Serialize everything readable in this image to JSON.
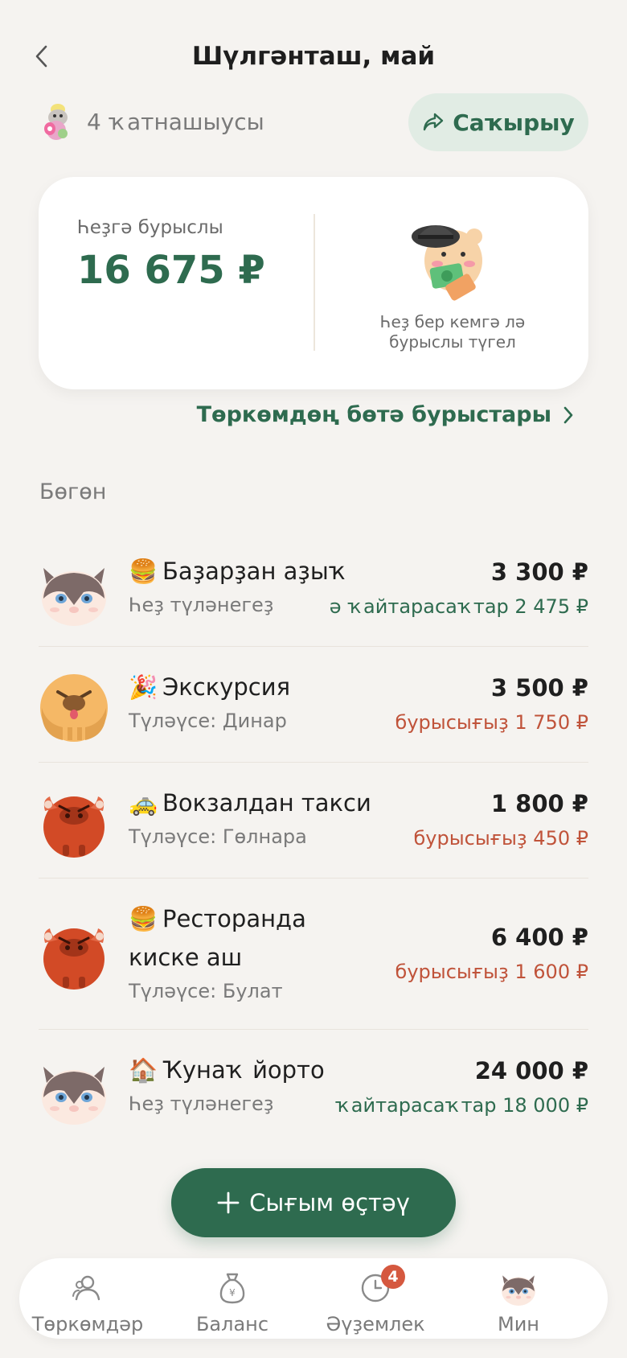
{
  "header": {
    "title": "Шүлгәнташ, май"
  },
  "participants": {
    "label": "4 ҡатнашыусы"
  },
  "invite": {
    "label": "Саҡырыу"
  },
  "balance": {
    "label": "Һеҙгә бурыслы",
    "amount": "16 675 ₽",
    "note_line1": "Һеҙ бер кемгә лә",
    "note_line2": "бурыслы түгел"
  },
  "all_debts_link": "Төркөмдөң бөтә бурыстары",
  "section_title": "Бөгөн",
  "expenses": [
    {
      "emoji": "🍔",
      "title": "Баҙарҙан аҙыҡ",
      "subtitle": "Һеҙ түләнегеҙ",
      "amount": "3 300 ₽",
      "status": "ә ҡайтарасаҡтар 2 475 ₽",
      "status_color": "green",
      "avatar": "cat-icon"
    },
    {
      "emoji": "🎉",
      "title": "Экскурсия",
      "subtitle": "Түләүсе: Динар",
      "amount": "3 500 ₽",
      "status": "бурысығыҙ 1 750 ₽",
      "status_color": "red",
      "avatar": "dog-icon"
    },
    {
      "emoji": "🚕",
      "title": "Вокзалдан такси",
      "subtitle": "Түләүсе: Гөлнара",
      "amount": "1 800 ₽",
      "status": "бурысығыҙ 450 ₽",
      "status_color": "red",
      "avatar": "bull-icon"
    },
    {
      "emoji": "🍔",
      "title_line1": "Ресторанда",
      "title_line2": "киске аш",
      "subtitle": "Түләүсе: Булат",
      "amount": "6 400 ₽",
      "status": "бурысығыҙ 1 600 ₽",
      "status_color": "red",
      "avatar": "bull-icon"
    },
    {
      "emoji": "🏠",
      "title": "Ҡунаҡ йорто",
      "subtitle": "Һеҙ түләнегеҙ",
      "amount": "24 000 ₽",
      "status": "ҡайтарасаҡтар 18 000 ₽",
      "status_color": "green",
      "avatar": "cat-icon"
    }
  ],
  "add_button": "Сығым өҫтәү",
  "tabs": [
    {
      "label": "Төркөмдәр",
      "icon": "groups-icon"
    },
    {
      "label": "Баланс",
      "icon": "money-bag-icon"
    },
    {
      "label": "Әүҙемлек",
      "icon": "clock-icon",
      "badge": "4"
    },
    {
      "label": "Мин",
      "icon": "cat-avatar-icon"
    }
  ],
  "colors": {
    "accent": "#2e6b4f",
    "red": "#c0533a",
    "background": "#f5f3f0",
    "badge": "#d5583f"
  }
}
